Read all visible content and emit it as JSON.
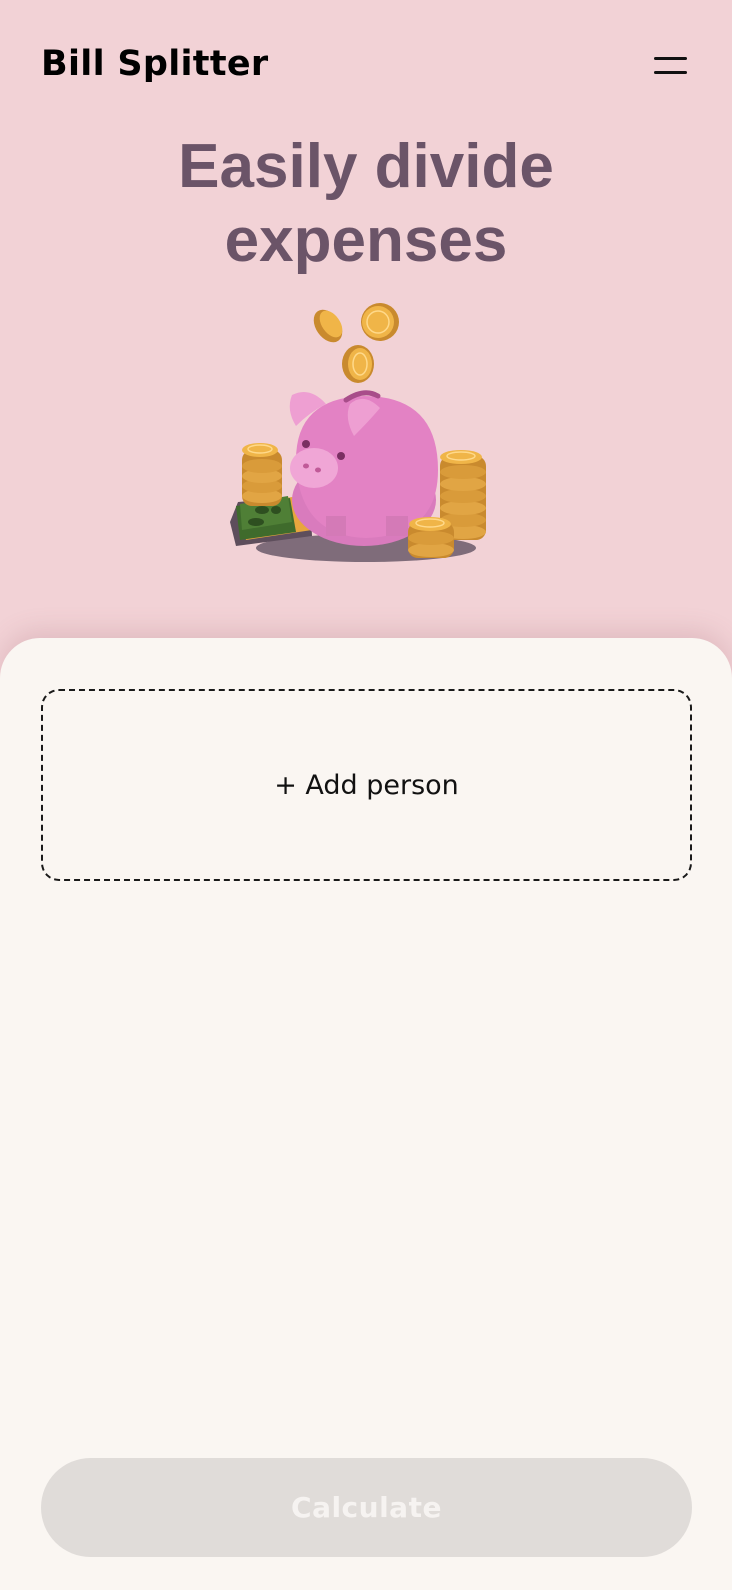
{
  "header": {
    "title": "Bill Splitter",
    "menu_icon": "hamburger-menu-icon"
  },
  "hero": {
    "heading_line1": "Easily divide",
    "heading_line2": "expenses",
    "illustration": "piggy-bank-with-coins-illustration"
  },
  "people": {
    "add_label": "+ Add person"
  },
  "actions": {
    "calculate_label": "Calculate"
  },
  "colors": {
    "background": "#f2d2d6",
    "heading": "#6b5468",
    "card": "#faf6f2",
    "button_disabled": "#e0dcd9"
  }
}
